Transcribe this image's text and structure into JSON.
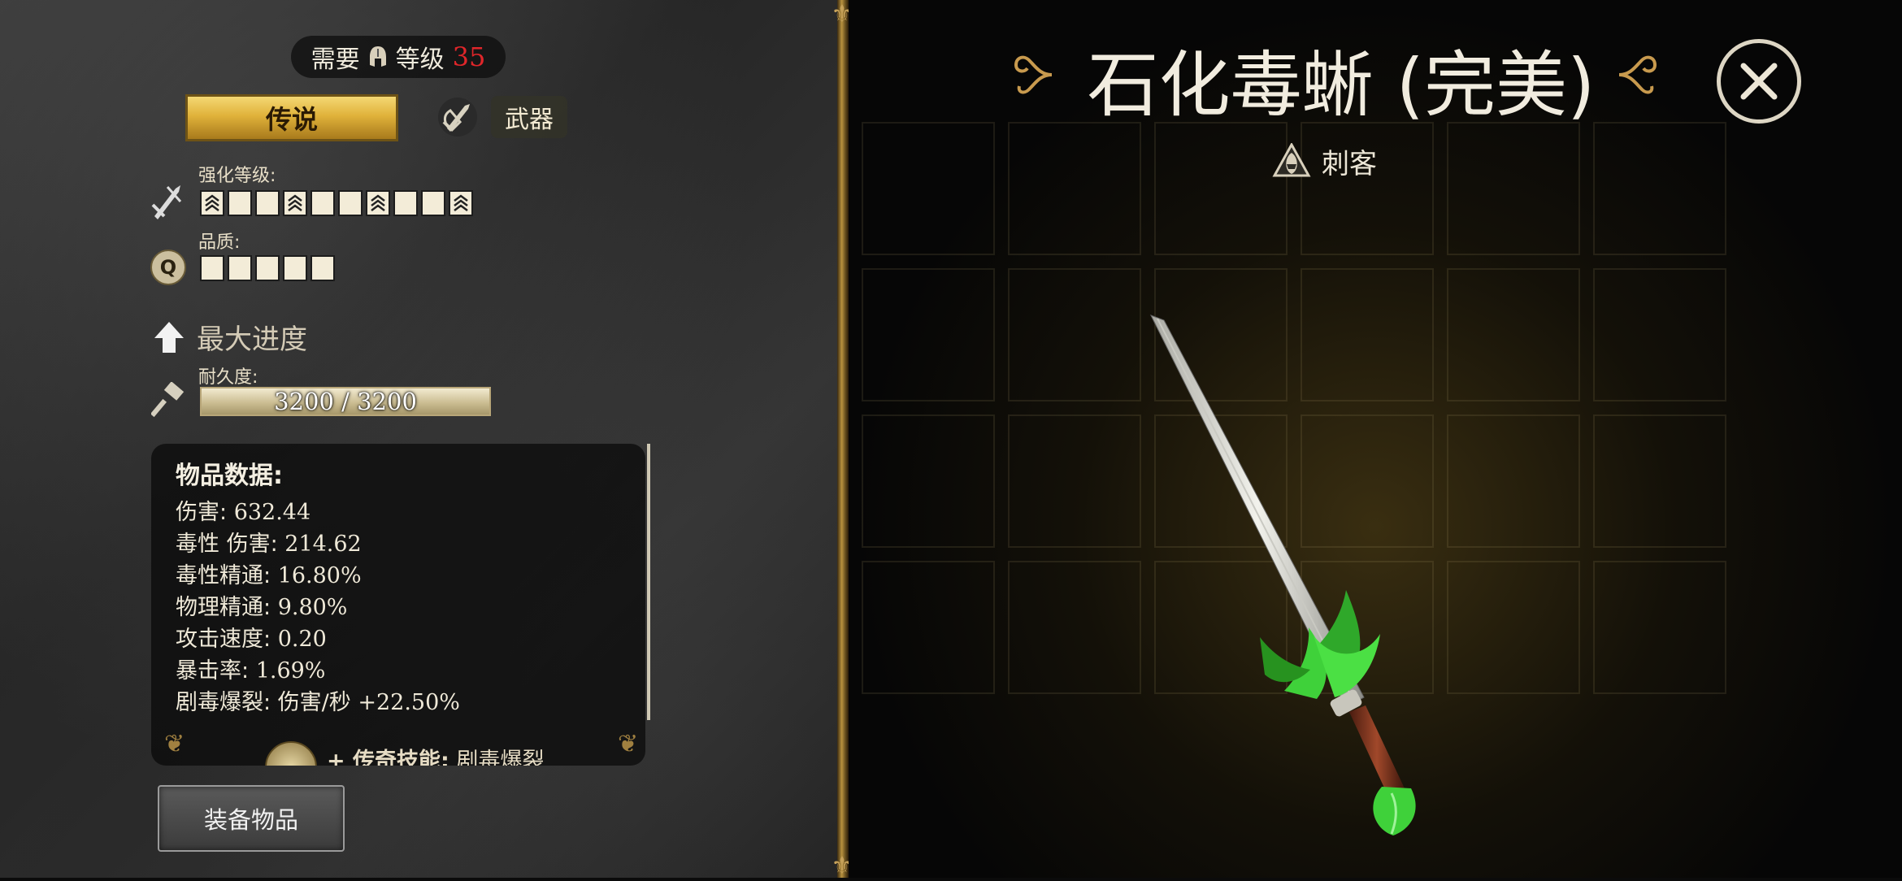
{
  "requirement": {
    "prefix": "需要",
    "label": "等级",
    "level": "35"
  },
  "rarity": "传说",
  "item_type": "武器",
  "enhance": {
    "label": "强化等级:",
    "cells": [
      "chev",
      "empty",
      "empty",
      "chev",
      "empty",
      "empty",
      "chev",
      "empty",
      "empty",
      "chev"
    ]
  },
  "quality": {
    "label": "品质:",
    "cells": 5,
    "icon_letter": "Q"
  },
  "max_progress": "最大进度",
  "durability": {
    "label": "耐久度:",
    "text": "3200 / 3200",
    "current": 3200,
    "max": 3200
  },
  "stats": {
    "title": "物品数据:",
    "rows": [
      {
        "k": "伤害: ",
        "v": "632.44"
      },
      {
        "k": "毒性 伤害: ",
        "v": "214.62"
      },
      {
        "k": "毒性精通: ",
        "v": "16.80%"
      },
      {
        "k": "物理精通: ",
        "v": "9.80%"
      },
      {
        "k": "攻击速度: ",
        "v": "0.20"
      },
      {
        "k": "暴击率: ",
        "v": "1.69%"
      },
      {
        "k": "剧毒爆裂: 伤害/秒 ",
        "v": "+22.50%"
      }
    ],
    "skill": {
      "prefix": "+ 传奇技能:",
      "name": " 剧毒爆裂"
    }
  },
  "equip_label": "装备物品",
  "item_name": "石化毒蜥 (完美)",
  "class_name": "刺客",
  "colors": {
    "gold": "#e0b23a",
    "level_red": "#e0262a",
    "venom_green": "#3fd13a"
  }
}
